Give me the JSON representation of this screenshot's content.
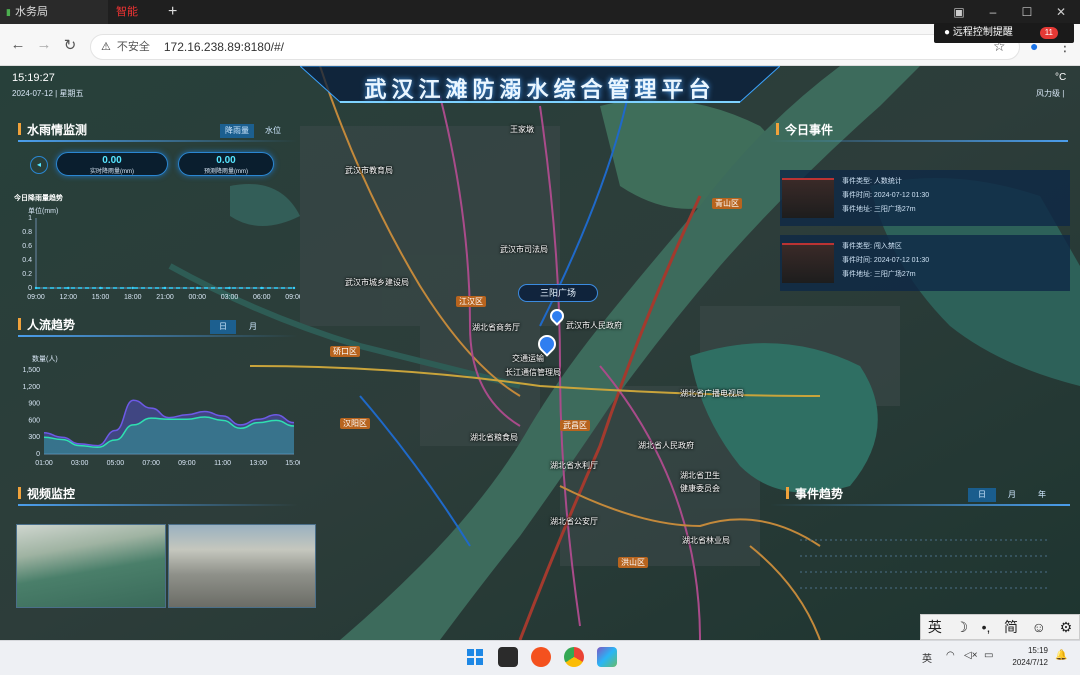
{
  "browser": {
    "tabs": [
      {
        "label": "水务局"
      },
      {
        "label": "智能"
      }
    ],
    "new_tab": "+",
    "close": "✕",
    "address": {
      "security": "不安全",
      "url": "172.16.238.89:8180/#/"
    },
    "notification": {
      "label": "远程控制提醒",
      "count": "11"
    }
  },
  "dashboard": {
    "title": "武汉江滩防溺水综合管理平台",
    "time": "15:19:27",
    "date": "2024-07-12 | 星期五",
    "weather": {
      "unit": "°C",
      "wind": "风力级 |"
    },
    "rain": {
      "title": "水雨情监测",
      "tabs": [
        "降雨量",
        "水位"
      ],
      "realtime": {
        "value": "0.00",
        "label": "实时降雨量(mm)"
      },
      "forecast": {
        "value": "0.00",
        "label": "预测降雨量(mm)"
      },
      "chart_title": "今日降雨量趋势",
      "unit": "单位(mm)"
    },
    "crowd": {
      "title": "人流趋势",
      "tabs": [
        "日",
        "月"
      ],
      "unit": "数量(人)"
    },
    "video": {
      "title": "视频监控"
    },
    "events": {
      "title": "今日事件",
      "items": [
        {
          "type_label": "事件类型:",
          "type": "人数统计",
          "time_label": "事件时间:",
          "time": "2024-07-12 01:30",
          "addr_label": "事件地址:",
          "addr": "三阳广场27m"
        },
        {
          "type_label": "事件类型:",
          "type": "闯入禁区",
          "time_label": "事件时间:",
          "time": "2024-07-12 01:30",
          "addr_label": "事件地址:",
          "addr": "三阳广场27m"
        }
      ]
    },
    "event_trend": {
      "title": "事件趋势",
      "tabs": [
        "日",
        "月",
        "年"
      ]
    },
    "map": {
      "popup": "三阳广场",
      "places": [
        "武汉市教育局",
        "武汉市司法局",
        "武汉市城乡建设局",
        "湖北省商务厅",
        "武汉市人民政府",
        "交通运输",
        "长江通信管理局",
        "湖北省粮食局",
        "湖北省广播电视局",
        "湖北省人民政府",
        "湖北省水利厅",
        "湖北省卫生",
        "健康委员会",
        "湖北省公安厅",
        "湖北省林业局",
        "王家墩"
      ],
      "districts": [
        "江岸区",
        "青山区",
        "江汉区",
        "硚口区",
        "汉阳区",
        "武昌区",
        "洪山区"
      ]
    }
  },
  "chart_data": [
    {
      "type": "line",
      "title": "今日降雨量趋势",
      "ylabel": "单位(mm)",
      "categories": [
        "09:00",
        "12:00",
        "15:00",
        "18:00",
        "21:00",
        "00:00",
        "03:00",
        "06:00",
        "09:00"
      ],
      "values": [
        0,
        0,
        0,
        0,
        0,
        0,
        0,
        0,
        0
      ],
      "ylim": [
        0,
        1
      ],
      "yticks": [
        "0",
        "0.2",
        "0.4",
        "0.6",
        "0.8",
        "1"
      ]
    },
    {
      "type": "area",
      "title": "人流趋势",
      "ylabel": "数量(人)",
      "categories": [
        "01:00",
        "03:00",
        "05:00",
        "07:00",
        "09:00",
        "11:00",
        "13:00",
        "15:00"
      ],
      "yticks": [
        "0",
        "300",
        "600",
        "900",
        "1,200",
        "1,500"
      ],
      "ylim": [
        0,
        1500
      ],
      "series": [
        {
          "name": "a",
          "values": [
            380,
            300,
            180,
            150,
            420,
            960,
            820,
            650,
            700,
            760,
            680,
            520,
            620,
            700,
            560
          ]
        },
        {
          "name": "b",
          "values": [
            300,
            260,
            150,
            120,
            250,
            520,
            640,
            620,
            620,
            660,
            600,
            460,
            560,
            600,
            500
          ]
        }
      ]
    }
  ],
  "ime": {
    "items": [
      "英",
      "☽",
      "•,",
      "简",
      "☺",
      "⚙"
    ]
  },
  "taskbar": {
    "ime": "英",
    "time": "15:19",
    "date": "2024/7/12"
  }
}
